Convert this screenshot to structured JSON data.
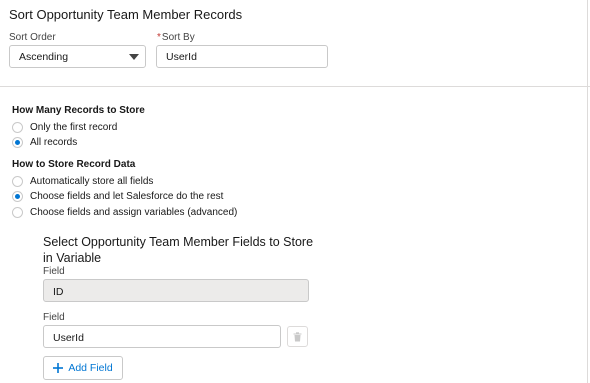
{
  "sort_section": {
    "title": "Sort Opportunity Team Member Records",
    "sort_order_label": "Sort Order",
    "sort_order_value": "Ascending",
    "sort_by_required": "*",
    "sort_by_label": "Sort By",
    "sort_by_value": "UserId"
  },
  "records_to_store": {
    "title": "How Many Records to Store",
    "options": [
      {
        "label": "Only the first record",
        "selected": false
      },
      {
        "label": "All records",
        "selected": true
      }
    ]
  },
  "record_data": {
    "title": "How to Store Record Data",
    "options": [
      {
        "label": "Automatically store all fields",
        "selected": false
      },
      {
        "label": "Choose fields and let Salesforce do the rest",
        "selected": true
      },
      {
        "label": "Choose fields and assign variables (advanced)",
        "selected": false
      }
    ]
  },
  "fields_panel": {
    "title": "Select Opportunity Team Member Fields to Store in Variable",
    "fields": [
      {
        "label": "Field",
        "value": "ID",
        "disabled": true
      },
      {
        "label": "Field",
        "value": "UserId",
        "disabled": false
      }
    ],
    "add_button_label": "Add Field"
  },
  "colors": {
    "accent": "#0176d3",
    "border": "#c9c9c9",
    "disabled_bg": "#ecebea",
    "required": "#c23934"
  },
  "icons": {
    "caret": "chevron-down-icon",
    "trash": "trash-icon",
    "add": "plus-icon"
  }
}
